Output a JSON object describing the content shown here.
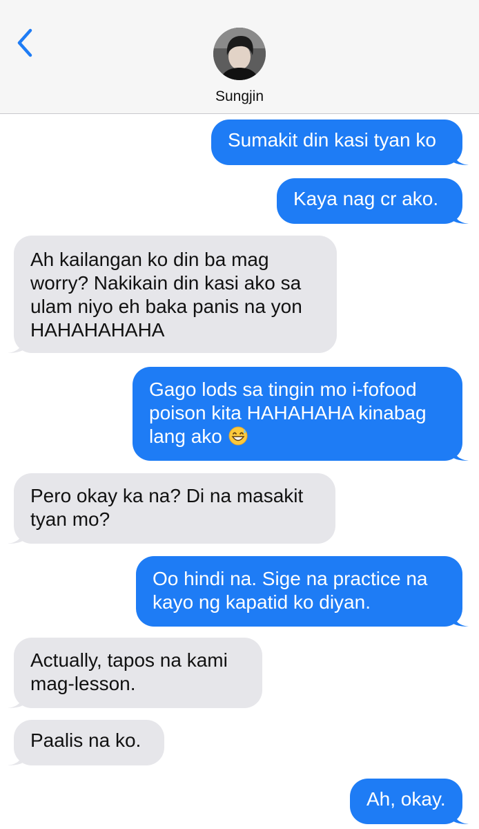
{
  "header": {
    "contact_name": "Sungjin",
    "back_icon": "chevron-left-icon",
    "accent_color": "#1e7cf5"
  },
  "messages": [
    {
      "direction": "outgoing",
      "text": "Sumakit din kasi tyan ko"
    },
    {
      "direction": "outgoing",
      "text": "Kaya nag cr ako."
    },
    {
      "direction": "incoming",
      "text": "Ah kailangan ko din ba mag worry? Nakikain din kasi ako sa ulam niyo eh baka panis na yon HAHAHAHAHA"
    },
    {
      "direction": "outgoing",
      "text": "Gago lods sa tingin mo i-fofood poison kita HAHAHAHA kinabag lang ako",
      "emoji": "grinning-face-with-sweat-emoji"
    },
    {
      "direction": "incoming",
      "text": "Pero okay ka na? Di na masakit tyan mo?"
    },
    {
      "direction": "outgoing",
      "text": "Oo hindi na. Sige na practice na kayo ng kapatid ko diyan."
    },
    {
      "direction": "incoming",
      "text": "Actually, tapos na kami mag-lesson."
    },
    {
      "direction": "incoming",
      "text": "Paalis na ko."
    },
    {
      "direction": "outgoing",
      "text": "Ah, okay."
    }
  ],
  "colors": {
    "outgoing_bubble": "#1e7cf5",
    "incoming_bubble": "#e6e6ea",
    "header_background": "#f6f6f6"
  }
}
